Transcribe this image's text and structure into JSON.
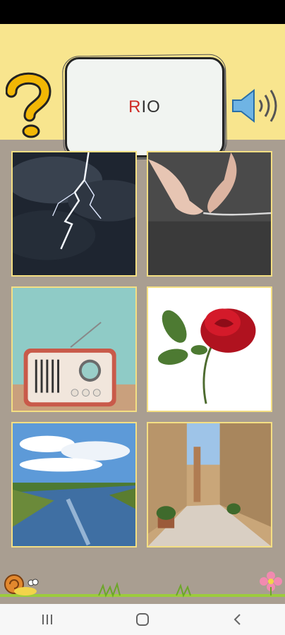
{
  "word": {
    "highlight": "R",
    "rest": "IO"
  },
  "colors": {
    "header_bg": "#f8e58e",
    "page_bg": "#a99e91",
    "highlight_letter": "#cf2b25",
    "tile_border": "#f4df83"
  },
  "icons": {
    "help": "question-mark-icon",
    "sound": "speaker-icon",
    "nav_recents": "recents-icon",
    "nav_home": "home-icon",
    "nav_back": "back-icon"
  },
  "tiles": [
    "lightning",
    "rope",
    "radio",
    "rose",
    "river",
    "street"
  ]
}
